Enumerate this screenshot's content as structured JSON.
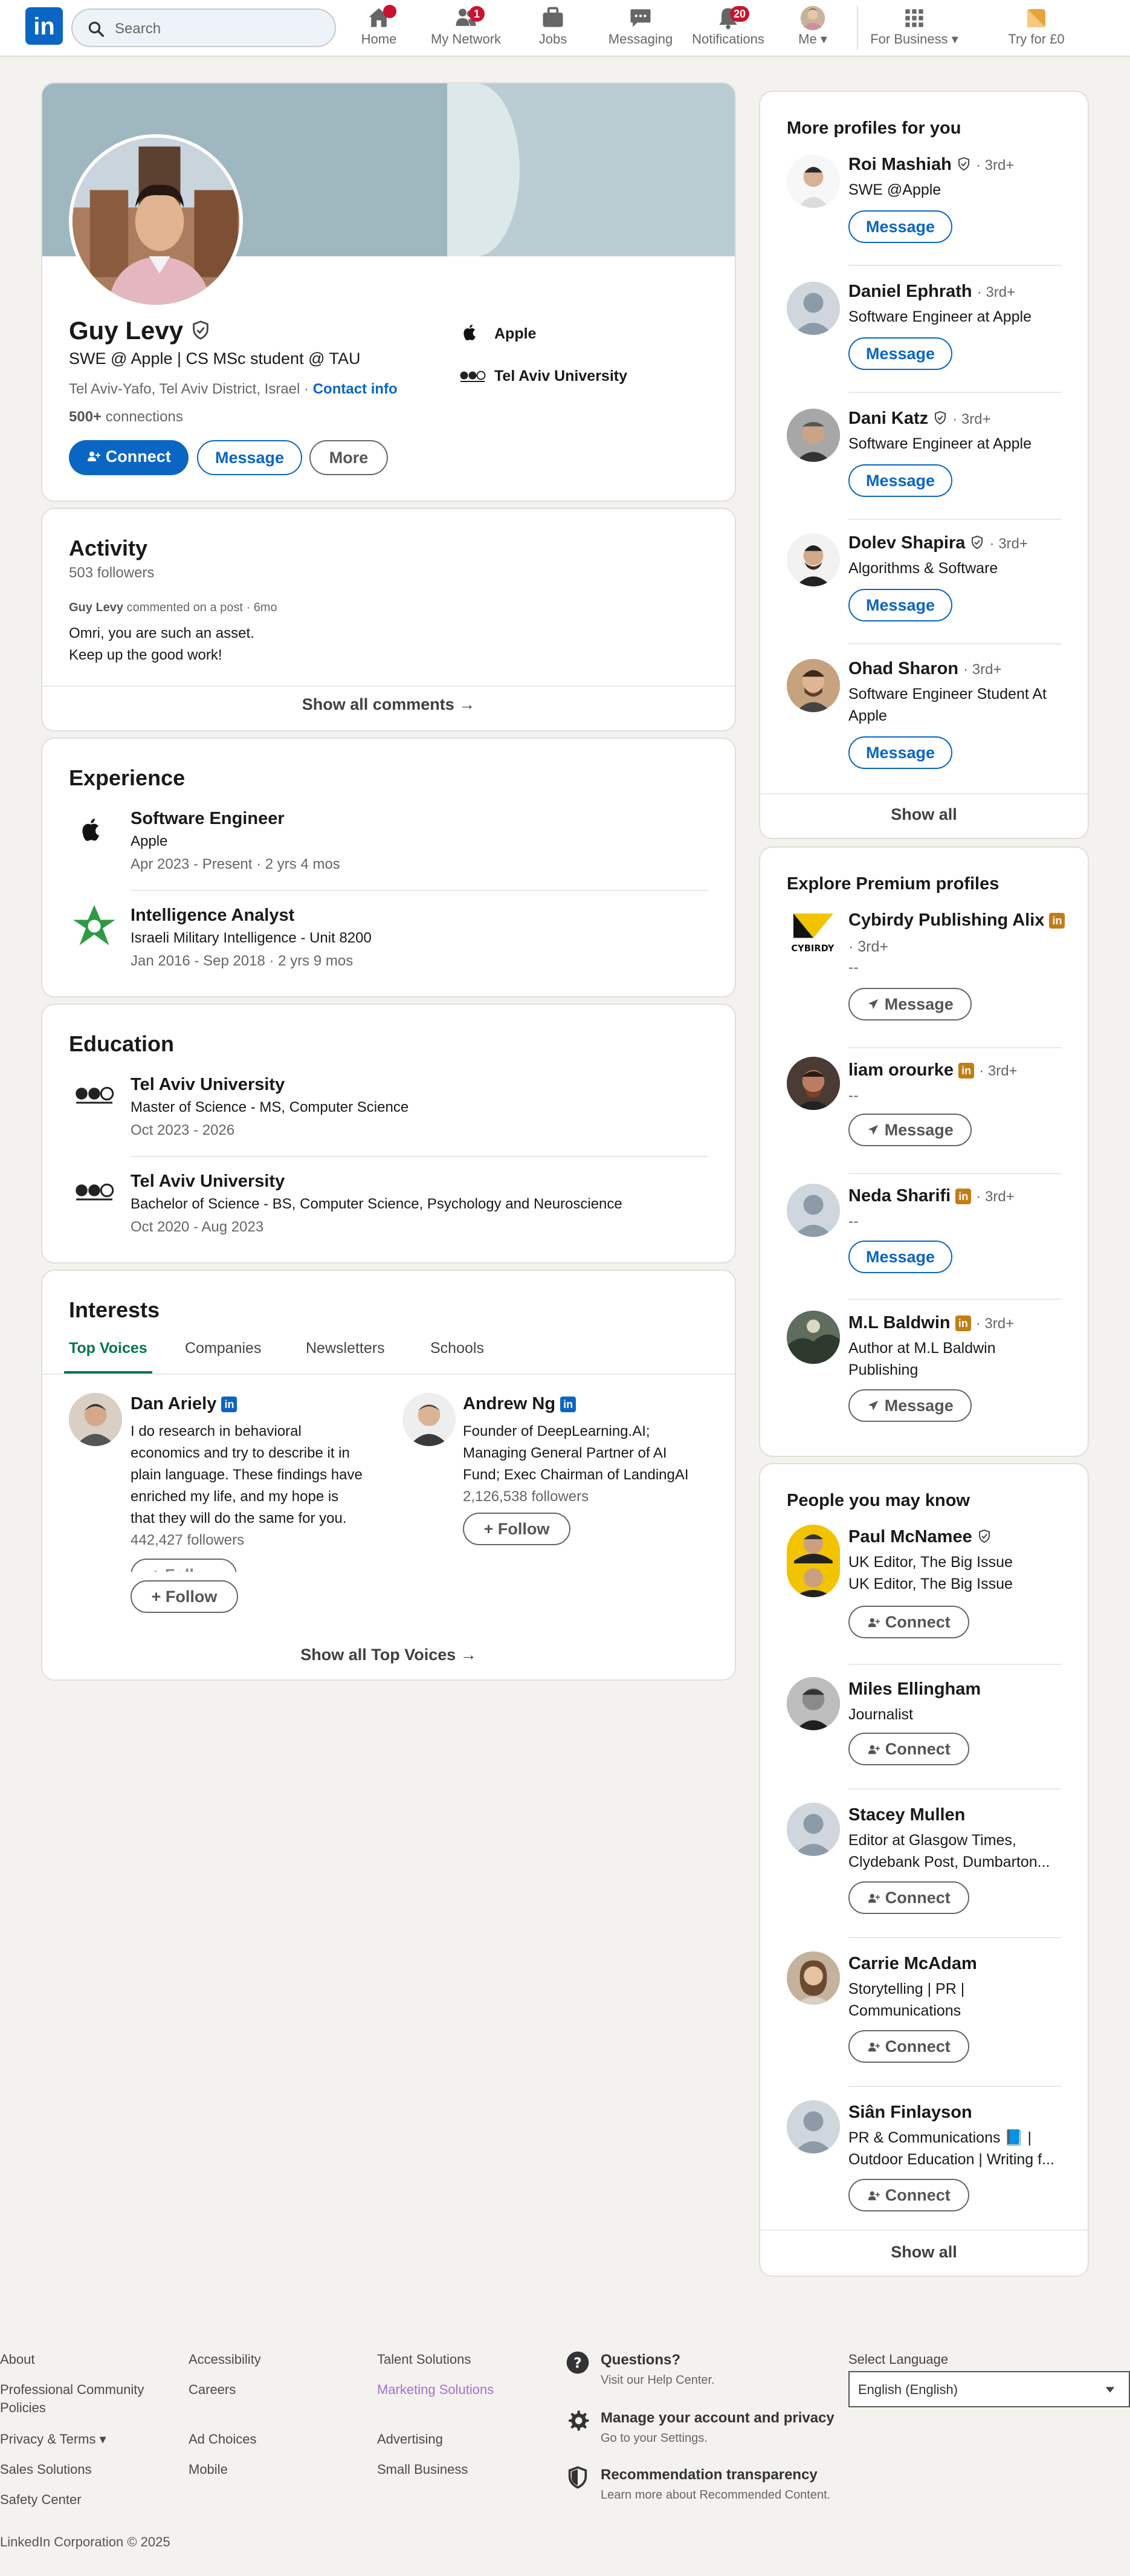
{
  "nav": {
    "logo": "in",
    "search_placeholder": "Search",
    "items": [
      {
        "label": "Home",
        "icon": "home-icon",
        "badge": ""
      },
      {
        "label": "My Network",
        "icon": "network-icon",
        "badge": "1"
      },
      {
        "label": "Jobs",
        "icon": "briefcase-icon",
        "badge": ""
      },
      {
        "label": "Messaging",
        "icon": "message-icon",
        "badge": ""
      },
      {
        "label": "Notifications",
        "icon": "bell-icon",
        "badge": "20"
      },
      {
        "label": "Me",
        "icon": "avatar-icon",
        "badge": ""
      },
      {
        "label": "For Business",
        "icon": "grid-icon",
        "badge": ""
      },
      {
        "label": "Try for £0",
        "icon": "premium-icon",
        "badge": ""
      }
    ]
  },
  "profile": {
    "name": "Guy Levy",
    "headline": "SWE @ Apple | CS MSc student @ TAU",
    "location": "Tel Aviv-Yafo, Tel Aviv District, Israel",
    "location_sep": "·",
    "contact_info": "Contact info",
    "connections_count": "500+",
    "connections_label": "connections",
    "company": "Apple",
    "school": "Tel Aviv University",
    "buttons": {
      "connect": "Connect",
      "message": "Message",
      "more": "More"
    }
  },
  "activity": {
    "title": "Activity",
    "followers": "503 followers",
    "meta_name": "Guy Levy",
    "meta_text": "commented on a post · 6mo",
    "comment_line1": "Omri, you are such an asset.",
    "comment_line2": "Keep up the good work!",
    "show_all": "Show all comments →"
  },
  "experience": {
    "title": "Experience",
    "items": [
      {
        "role": "Software Engineer",
        "org": "Apple",
        "dates": "Apr 2023 - Present · 2 yrs 4 mos"
      },
      {
        "role": "Intelligence Analyst",
        "org": "Israeli Military Intelligence - Unit 8200",
        "dates": "Jan 2016 - Sep 2018 · 2 yrs 9 mos"
      }
    ]
  },
  "education": {
    "title": "Education",
    "items": [
      {
        "school": "Tel Aviv University",
        "degree": "Master of Science - MS, Computer Science",
        "dates": "Oct 2023 - 2026"
      },
      {
        "school": "Tel Aviv University",
        "degree": "Bachelor of Science - BS, Computer Science, Psychology and Neuroscience",
        "dates": "Oct 2020 - Aug 2023"
      }
    ]
  },
  "interests": {
    "title": "Interests",
    "tabs": [
      "Top Voices",
      "Companies",
      "Newsletters",
      "Schools"
    ],
    "voices": [
      {
        "name": "Dan Ariely",
        "desc1": "I do research in behavioral",
        "desc2": "economics and try to describe it in",
        "desc3": "plain language. These findings have",
        "desc4": "enriched my life, and my hope is",
        "desc5": "that they will do the same for you.",
        "followers": "442,427 followers",
        "ghost": "+ Follow",
        "follow": "Follow"
      },
      {
        "name": "Andrew Ng",
        "desc1": "Founder of DeepLearning.AI;",
        "desc2": "Managing General Partner of AI",
        "desc3": "Fund; Exec Chairman of LandingAI",
        "followers": "2,126,538 followers",
        "follow": "Follow"
      }
    ],
    "show_all": "Show all Top Voices →"
  },
  "more_profiles": {
    "title": "More profiles for you",
    "items": [
      {
        "name": "Roi Mashiah",
        "degree": "· 3rd+",
        "line1": "SWE @Apple",
        "line2": "",
        "button": "Message"
      },
      {
        "name": "Daniel Ephrath",
        "degree": "· 3rd+",
        "line1": "Software Engineer at Apple",
        "line2": "",
        "button": "Message"
      },
      {
        "name": "Dani Katz",
        "degree": "· 3rd+",
        "line1": "Software Engineer at Apple",
        "line2": "",
        "button": "Message"
      },
      {
        "name": "Dolev Shapira",
        "degree": "· 3rd+",
        "line1": "Algorithms & Software",
        "line2": "",
        "button": "Message"
      },
      {
        "name": "Ohad Sharon",
        "degree": "· 3rd+",
        "line1": "Software Engineer Student At",
        "line2": "Apple",
        "button": "Message"
      }
    ],
    "show_all": "Show all"
  },
  "premium": {
    "title": "Explore Premium profiles",
    "items": [
      {
        "name": "Cybirdy Publishing Alix",
        "degree": "· 3rd+",
        "line1": "--",
        "line2": "",
        "button": "Message"
      },
      {
        "name": "liam orourke",
        "degree": "· 3rd+",
        "line1": "--",
        "line2": "",
        "button": "Message"
      },
      {
        "name": "Neda Sharifi",
        "degree": "· 3rd+",
        "line1": "--",
        "line2": "",
        "button": "Message"
      },
      {
        "name": "M.L Baldwin",
        "degree": "· 3rd+",
        "line1": "Author at M.L Baldwin",
        "line2": "Publishing",
        "button": "Message"
      }
    ]
  },
  "pymk": {
    "title": "People you may know",
    "items": [
      {
        "name": "Paul McNamee",
        "line1": "UK Editor, The Big Issue",
        "line2": "UK Editor, The Big Issue",
        "button": "Connect"
      },
      {
        "name": "Miles Ellingham",
        "line1": "Journalist",
        "line2": "",
        "button": "Connect"
      },
      {
        "name": "Stacey Mullen",
        "line1": "Editor at Glasgow Times,",
        "line2": "Clydebank Post, Dumbarton...",
        "button": "Connect"
      },
      {
        "name": "Carrie McAdam",
        "line1": "Storytelling | PR |",
        "line2": "Communications",
        "button": "Connect"
      },
      {
        "name": "Siân Finlayson",
        "line1": "PR & Communications 📘 |",
        "line2": "Outdoor Education | Writing f...",
        "button": "Connect"
      }
    ],
    "show_all": "Show all"
  },
  "footer": {
    "col1": [
      "About",
      "Professional Community",
      "Policies",
      "Privacy & Terms ▾",
      "Sales Solutions",
      "Safety Center"
    ],
    "col2": [
      "Accessibility",
      "Careers",
      "Ad Choices",
      "Mobile"
    ],
    "col3": [
      "Talent Solutions",
      "Marketing Solutions",
      "Advertising",
      "Small Business"
    ],
    "help_title": "Questions?",
    "help_sub": "Visit our Help Center.",
    "manage_title": "Manage your account and privacy",
    "manage_sub": "Go to your Settings.",
    "rec_title": "Recommendation transparency",
    "rec_sub": "Learn more about Recommended Content.",
    "lang_label": "Select Language",
    "lang_value": "English (English)",
    "copyright": "LinkedIn Corporation © 2025"
  },
  "colors": {
    "brand": "#0a66c2",
    "badge": "#cb112d",
    "premium": "#c37d16",
    "active_tab": "#01754f"
  }
}
